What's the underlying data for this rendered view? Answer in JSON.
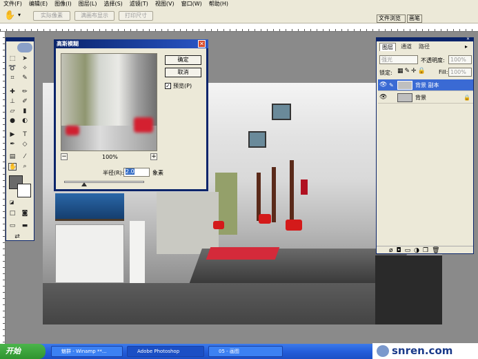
{
  "menu": [
    "文件(F)",
    "编辑(E)",
    "图像(I)",
    "图层(L)",
    "选择(S)",
    "滤镜(T)",
    "视图(V)",
    "窗口(W)",
    "帮助(H)"
  ],
  "options_bar": {
    "actual_pixels": "实际像素",
    "fit_screen": "满画布显示",
    "print_size": "打印尺寸",
    "tab_file_browser": "文件浏览",
    "tab_brushes": "画笔"
  },
  "dialog": {
    "title": "高斯模糊",
    "ok": "确定",
    "cancel": "取消",
    "preview_label": "预览(P)",
    "preview_checked": true,
    "zoom": "100%",
    "radius_label": "半径(R):",
    "radius_value": "2.0",
    "unit": "象素",
    "zoom_out": "−",
    "zoom_in": "+",
    "slider_position": 0.25
  },
  "layers_panel": {
    "tabs": [
      "图层",
      "通道",
      "路径"
    ],
    "blend_mode": "强光",
    "opacity_label": "不透明度:",
    "opacity_value": "100%",
    "lock_label": "锁定:",
    "fill_label": "Fill:",
    "fill_value": "100%",
    "layers": [
      {
        "name": "背景 副本",
        "selected": true
      },
      {
        "name": "背景",
        "selected": false
      }
    ]
  },
  "taskbar": {
    "start": "开始",
    "items": [
      "魅群 - Winamp **...",
      "Adobe Photoshop",
      "05 - 画图"
    ]
  },
  "watermark": "snren.com",
  "colors": {
    "titlebar": "#0a246a",
    "chrome": "#ece9d8",
    "taskbar": "#245edb",
    "start": "#2f942f"
  }
}
